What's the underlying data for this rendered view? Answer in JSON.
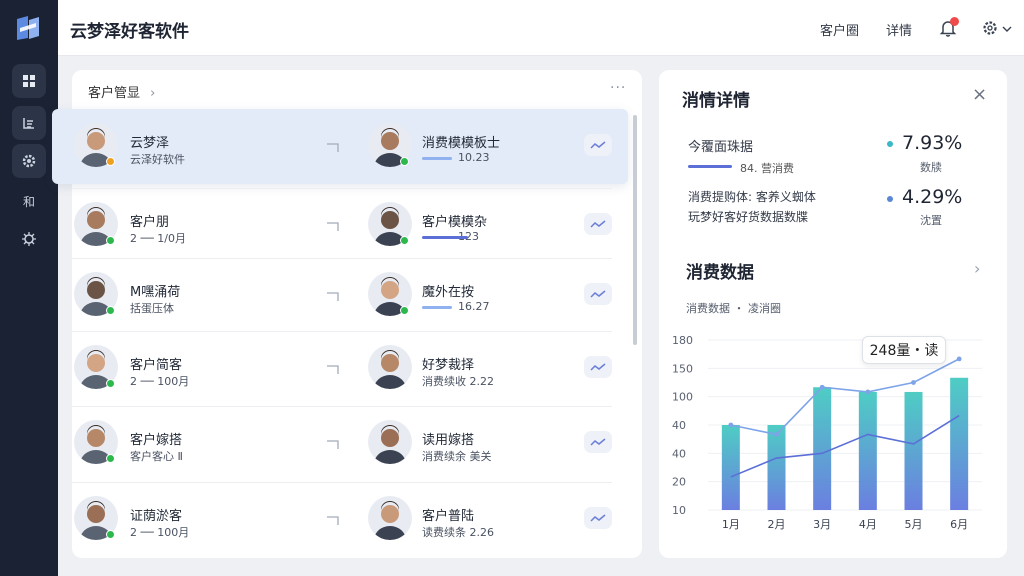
{
  "header": {
    "title": "云梦泽好客软件",
    "links": [
      "客户圈",
      "详情"
    ],
    "notification_count_shown": true
  },
  "sidebar": {
    "items": [
      {
        "icon": "grid-icon",
        "active": true
      },
      {
        "icon": "list-icon",
        "active": true
      },
      {
        "icon": "gear-icon",
        "active": true
      },
      {
        "icon": "text-icon",
        "label": "和",
        "active": false
      },
      {
        "icon": "bug-icon",
        "active": false
      }
    ]
  },
  "customers": {
    "breadcrumb": "客户管显",
    "more": "···",
    "rows": [
      {
        "left": {
          "name": "云梦泽",
          "sub": "云泽好软件",
          "status": "#f0a020"
        },
        "right": {
          "name": "消费模模板士",
          "sub": "10.23",
          "status": "#2db84d"
        }
      },
      {
        "left": {
          "name": "客户朋",
          "sub": "2 ── 1/0月",
          "status": "#2db84d"
        },
        "right": {
          "name": "客户模模杂",
          "sub": "123",
          "status": "#2db84d"
        }
      },
      {
        "left": {
          "name": "M嘿涌荷",
          "sub": "括蛋压体",
          "status": "#2db84d"
        },
        "right": {
          "name": "魔外在按",
          "sub": "16.27",
          "status": "#2db84d"
        }
      },
      {
        "left": {
          "name": "客户简客",
          "sub": "2 ── 100月",
          "status": "#2db84d"
        },
        "right": {
          "name": "好梦裁择",
          "sub": "消费续收 2.22",
          "status": ""
        }
      },
      {
        "left": {
          "name": "客户嫁搭",
          "sub": "客户客心 Ⅱ",
          "status": "#2db84d"
        },
        "right": {
          "name": "读用嫁搭",
          "sub": "消费续余 美关",
          "status": ""
        }
      },
      {
        "left": {
          "name": "证荫淤客",
          "sub": "2 ── 100月",
          "status": "#2db84d"
        },
        "right": {
          "name": "客户普陆",
          "sub": "读费续条 2.26",
          "status": ""
        }
      }
    ]
  },
  "details": {
    "title": "消情详情",
    "close": "×",
    "stat1": {
      "label": "今覆面珠据",
      "sub": "84. 营消费",
      "value": "7.93%",
      "caption": "数牍",
      "color": "#3ab8c8"
    },
    "stat2": {
      "label": "消费提购体: 客养义蜘体",
      "label2": "玩梦好客好货数据数牒",
      "value": "4.29%",
      "caption": "沈置",
      "color": "#5b87d6"
    },
    "section_title": "消费数据",
    "legend": "消费数据 ・ 凌消圈",
    "tooltip": "248量・读"
  },
  "chart_data": {
    "type": "bar",
    "categories": [
      "1月",
      "2月",
      "3月",
      "4月",
      "5月",
      "6月"
    ],
    "yticks": [
      "10",
      "20",
      "40",
      "40",
      "100",
      "150",
      "180"
    ],
    "ylim": [
      0,
      180
    ],
    "series": [
      {
        "values": [
          90,
          90,
          130,
          125,
          125,
          140
        ]
      },
      {
        "values": [
          90,
          80,
          130,
          125,
          135,
          160
        ]
      },
      {
        "values": [
          35,
          55,
          60,
          80,
          70,
          100
        ]
      }
    ],
    "colors": {
      "bar_top": "#4ecdc4",
      "bar_bottom": "#6b7fe0",
      "line": "#5b6fd6",
      "line_light": "#7ea4e8"
    }
  }
}
